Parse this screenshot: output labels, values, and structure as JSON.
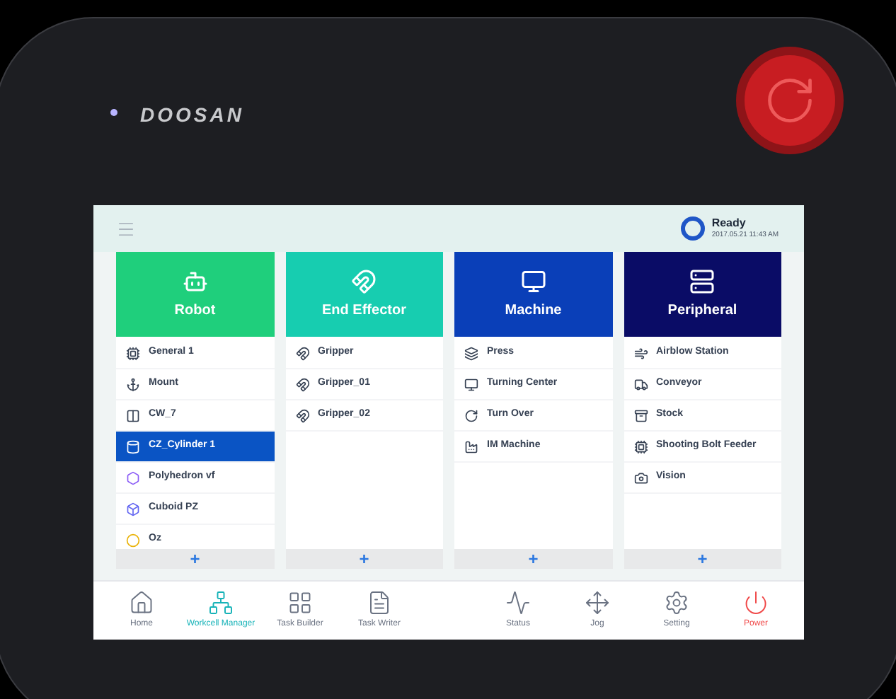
{
  "device": {
    "brand": "DOOSAN"
  },
  "status": {
    "state": "Ready",
    "datetime": "2017.05.21 11:43 AM"
  },
  "columns": [
    {
      "title": "Robot",
      "color": "#1fcf7c",
      "items": [
        {
          "label": "General 1",
          "selected": false
        },
        {
          "label": "Mount",
          "selected": false
        },
        {
          "label": "CW_7",
          "selected": false
        },
        {
          "label": "CZ_Cylinder 1",
          "selected": true
        },
        {
          "label": "Polyhedron vf",
          "selected": false
        },
        {
          "label": "Cuboid PZ",
          "selected": false
        },
        {
          "label": "Oz",
          "selected": false
        }
      ],
      "add": "+"
    },
    {
      "title": "End Effector",
      "color": "#17cdb0",
      "items": [
        {
          "label": "Gripper",
          "selected": false
        },
        {
          "label": "Gripper_01",
          "selected": false
        },
        {
          "label": "Gripper_02",
          "selected": false
        }
      ],
      "add": "+"
    },
    {
      "title": "Machine",
      "color": "#0a3fb8",
      "items": [
        {
          "label": "Press",
          "selected": false
        },
        {
          "label": "Turning Center",
          "selected": false
        },
        {
          "label": "Turn Over",
          "selected": false
        },
        {
          "label": "IM Machine",
          "selected": false
        }
      ],
      "add": "+"
    },
    {
      "title": "Peripheral",
      "color": "#0a0c66",
      "items": [
        {
          "label": "Airblow Station",
          "selected": false
        },
        {
          "label": "Conveyor",
          "selected": false
        },
        {
          "label": "Stock",
          "selected": false
        },
        {
          "label": "Shooting Bolt Feeder",
          "selected": false
        },
        {
          "label": "Vision",
          "selected": false
        }
      ],
      "add": "+"
    }
  ],
  "nav_left": [
    {
      "label": "Home",
      "selected": false
    },
    {
      "label": "Workcell Manager",
      "selected": true
    },
    {
      "label": "Task Builder",
      "selected": false
    },
    {
      "label": "Task Writer",
      "selected": false
    }
  ],
  "nav_right": [
    {
      "label": "Status",
      "selected": false,
      "kind": "nav"
    },
    {
      "label": "Jog",
      "selected": false,
      "kind": "nav"
    },
    {
      "label": "Setting",
      "selected": false,
      "kind": "nav"
    },
    {
      "label": "Power",
      "selected": false,
      "kind": "power"
    }
  ]
}
